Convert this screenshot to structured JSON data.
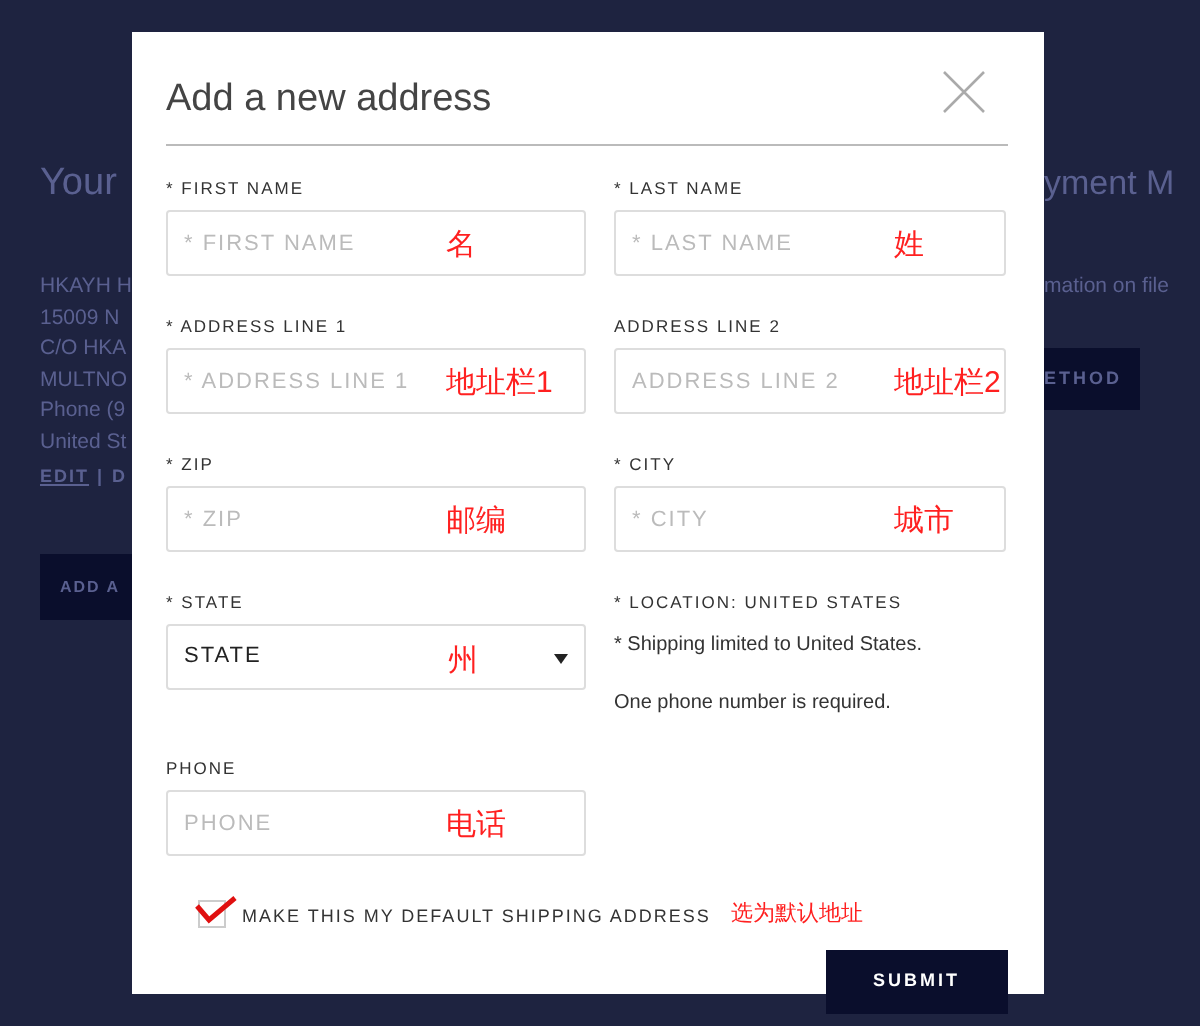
{
  "background_page": {
    "left_heading": "Your",
    "address_lines": [
      "HKAYH H",
      "15009 N",
      "C/O HKA",
      "MULTNO",
      "Phone (9",
      "United St"
    ],
    "edit_link": "EDIT",
    "separator": "|",
    "delete_link": "D",
    "add_button": "ADD A",
    "right_heading": "yment M",
    "right_text": "mation on file",
    "right_button": "ETHOD"
  },
  "modal": {
    "title": "Add a new address",
    "fields": [
      {
        "label": "* FIRST NAME",
        "placeholder": "* FIRST NAME",
        "annotation": "名",
        "kind": "input"
      },
      {
        "label": "* LAST NAME",
        "placeholder": "* LAST NAME",
        "annotation": "姓",
        "kind": "input"
      },
      {
        "label": "* ADDRESS LINE 1",
        "placeholder": "* ADDRESS LINE 1",
        "annotation": "地址栏1",
        "kind": "input"
      },
      {
        "label": "ADDRESS LINE 2",
        "placeholder": "ADDRESS LINE 2",
        "annotation": "地址栏2",
        "kind": "input"
      },
      {
        "label": "* ZIP",
        "placeholder": "* ZIP",
        "annotation": "邮编",
        "kind": "input"
      },
      {
        "label": "* CITY",
        "placeholder": "* CITY",
        "annotation": "城市",
        "kind": "input"
      },
      {
        "label": "* STATE",
        "value": "STATE",
        "annotation": "州",
        "kind": "select"
      },
      {
        "label": "* LOCATION: UNITED STATES",
        "notes": [
          "* Shipping limited to United States.",
          "One phone number is required."
        ],
        "kind": "info"
      },
      {
        "label": "PHONE",
        "placeholder": "PHONE",
        "annotation": "电话",
        "kind": "input"
      }
    ],
    "default_checkbox": {
      "label": "MAKE THIS MY DEFAULT SHIPPING ADDRESS",
      "checked": true,
      "annotation": "选为默认地址"
    },
    "submit": "SUBMIT"
  }
}
